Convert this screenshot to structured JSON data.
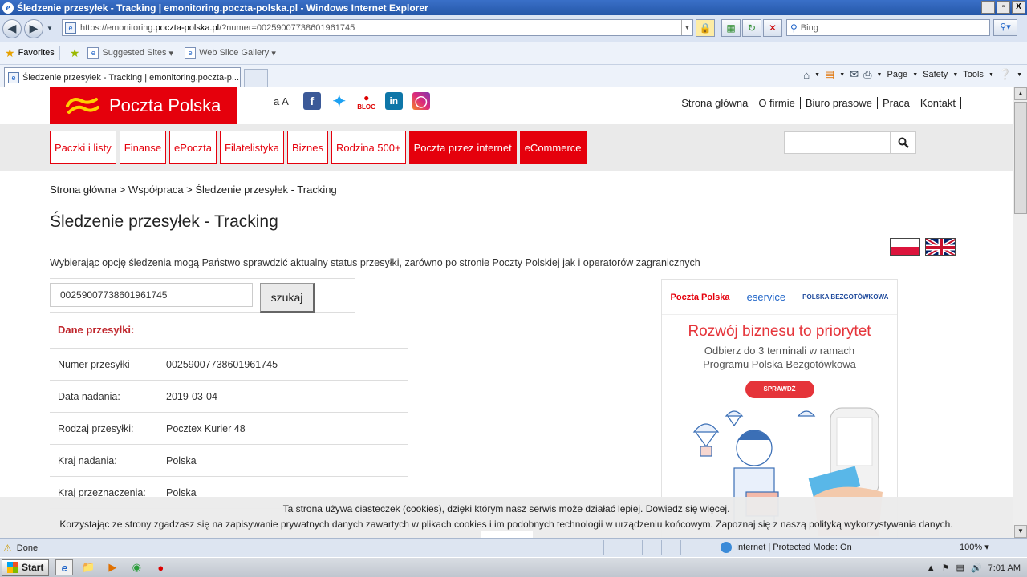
{
  "window": {
    "title": "Śledzenie przesyłek - Tracking | emonitoring.poczta-polska.pl - Windows Internet Explorer",
    "min": "_",
    "max": "▫",
    "close": "X"
  },
  "address": {
    "url_prefix": "https://emonitoring.",
    "url_domain": "poczta-polska.pl",
    "url_suffix": "/?numer=00259007738601961745",
    "search_placeholder": "Bing"
  },
  "favorites": {
    "favorites_label": "Favorites",
    "suggested_sites": "Suggested Sites",
    "web_slice_gallery": "Web Slice Gallery"
  },
  "tab": {
    "title": "Śledzenie przesyłek - Tracking | emonitoring.poczta-p...",
    "commands": {
      "page": "Page",
      "safety": "Safety",
      "tools": "Tools"
    }
  },
  "site": {
    "logo_text": "Poczta Polska",
    "font_toggle": "a A",
    "blog_label": "BLOG",
    "top_links": [
      "Strona główna",
      "O firmie",
      "Biuro prasowe",
      "Praca",
      "Kontakt"
    ],
    "nav": [
      "Paczki i listy",
      "Finanse",
      "ePoczta",
      "Filatelistyka",
      "Biznes",
      "Rodzina 500+",
      "Poczta przez internet",
      "eCommerce"
    ],
    "breadcrumb": "Strona główna > Współpraca > Śledzenie przesyłek - Tracking",
    "page_title": "Śledzenie przesyłek - Tracking",
    "intro": "Wybierając opcję śledzenia mogą Państwo sprawdzić aktualny status przesyłki, zarówno po stronie Poczty Polskiej jak i operatorów zagranicznych",
    "tracking_number": "00259007738601961745",
    "search_button": "szukaj",
    "details_heading": "Dane przesyłki:",
    "details": [
      {
        "key": "Numer przesyłki",
        "value": "00259007738601961745"
      },
      {
        "key": "Data nadania:",
        "value": "2019-03-04"
      },
      {
        "key": "Rodzaj przesyłki:",
        "value": "Pocztex Kurier 48"
      },
      {
        "key": "Kraj nadania:",
        "value": "Polska"
      },
      {
        "key": "Kraj przeznaczenia:",
        "value": "Polska"
      }
    ]
  },
  "ad": {
    "brand1": "Poczta Polska",
    "brand2": "eservice",
    "brand3": "POLSKA BEZGOTÓWKOWA",
    "headline": "Rozwój biznesu to priorytet",
    "sub1": "Odbierz do 3 terminali w ramach",
    "sub2": "Programu Polska Bezgotówkowa",
    "cta": "SPRAWDŹ"
  },
  "cookie": {
    "line1": "Ta strona używa ciasteczek (cookies), dzięki którym nasz serwis może działać lepiej. Dowiedz się więcej.",
    "line2": "Korzystając ze strony zgadzasz się na zapisywanie prywatnych danych zawartych w plikach cookies i im podobnych technologii w urządzeniu końcowym. Zapoznaj się z naszą polityką wykorzystywania danych."
  },
  "status": {
    "left": "Done",
    "zone": "Internet | Protected Mode: On",
    "zoom": "100%"
  },
  "taskbar": {
    "start": "Start",
    "clock": "7:01 AM"
  },
  "colors": {
    "brand_red": "#e5000c",
    "ie_blue": "#2557a8"
  }
}
